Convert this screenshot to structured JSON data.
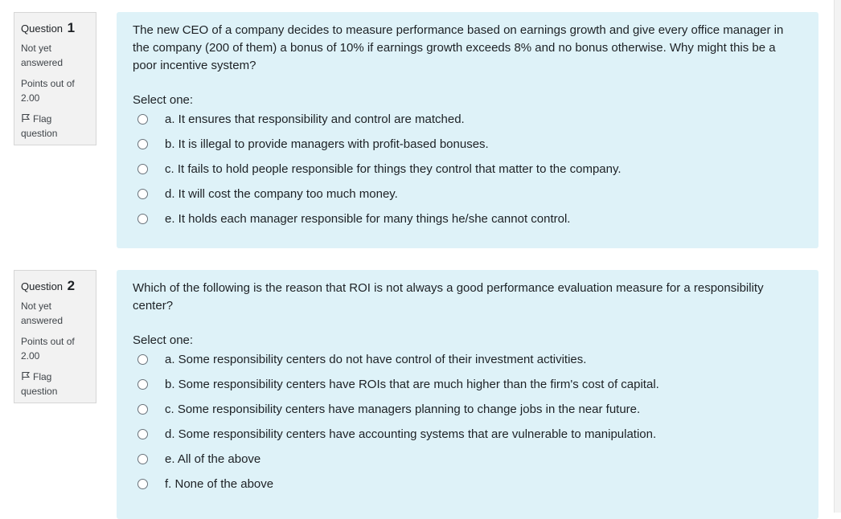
{
  "questions": [
    {
      "label": "Question",
      "number": "1",
      "state": "Not yet answered",
      "grade": "Points out of 2.00",
      "flag_label": "Flag question",
      "text": "The new CEO of a company decides to measure performance based on earnings growth and give every office manager in the company (200 of them) a bonus of 10% if earnings growth exceeds 8% and no bonus otherwise. Why might this be a poor incentive system?",
      "prompt": "Select one:",
      "answers": [
        "a. It ensures that responsibility and control are matched.",
        "b. It is illegal to provide managers with profit-based bonuses.",
        "c. It fails to hold people responsible for things they control that matter to the company.",
        "d. It will cost the company too much money.",
        "e. It holds each manager responsible for many things he/she cannot control."
      ]
    },
    {
      "label": "Question",
      "number": "2",
      "state": "Not yet answered",
      "grade": "Points out of 2.00",
      "flag_label": "Flag question",
      "text": "Which of the following is the reason that ROI is not always a good performance evaluation measure for a responsibility center?",
      "prompt": "Select one:",
      "answers": [
        "a. Some responsibility centers do not have control of their investment activities.",
        "b. Some responsibility centers have ROIs that are much higher than the firm's cost of capital.",
        "c. Some responsibility centers have managers planning to change jobs in the near future.",
        "d. Some responsibility centers have accounting systems that are vulnerable to manipulation.",
        "e. All of the above",
        "f. None of the above"
      ]
    }
  ],
  "icons": {
    "flag": "flag-outline-icon",
    "radio": "radio-unselected-icon"
  }
}
